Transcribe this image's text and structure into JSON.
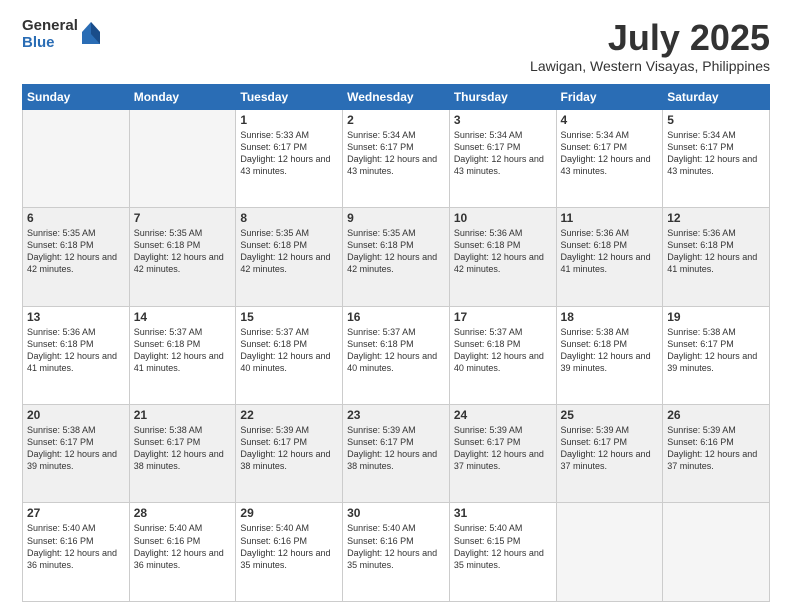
{
  "logo": {
    "general": "General",
    "blue": "Blue"
  },
  "header": {
    "month": "July 2025",
    "location": "Lawigan, Western Visayas, Philippines"
  },
  "weekdays": [
    "Sunday",
    "Monday",
    "Tuesday",
    "Wednesday",
    "Thursday",
    "Friday",
    "Saturday"
  ],
  "weeks": [
    [
      {
        "day": "",
        "info": ""
      },
      {
        "day": "",
        "info": ""
      },
      {
        "day": "1",
        "info": "Sunrise: 5:33 AM\nSunset: 6:17 PM\nDaylight: 12 hours and 43 minutes."
      },
      {
        "day": "2",
        "info": "Sunrise: 5:34 AM\nSunset: 6:17 PM\nDaylight: 12 hours and 43 minutes."
      },
      {
        "day": "3",
        "info": "Sunrise: 5:34 AM\nSunset: 6:17 PM\nDaylight: 12 hours and 43 minutes."
      },
      {
        "day": "4",
        "info": "Sunrise: 5:34 AM\nSunset: 6:17 PM\nDaylight: 12 hours and 43 minutes."
      },
      {
        "day": "5",
        "info": "Sunrise: 5:34 AM\nSunset: 6:17 PM\nDaylight: 12 hours and 43 minutes."
      }
    ],
    [
      {
        "day": "6",
        "info": "Sunrise: 5:35 AM\nSunset: 6:18 PM\nDaylight: 12 hours and 42 minutes."
      },
      {
        "day": "7",
        "info": "Sunrise: 5:35 AM\nSunset: 6:18 PM\nDaylight: 12 hours and 42 minutes."
      },
      {
        "day": "8",
        "info": "Sunrise: 5:35 AM\nSunset: 6:18 PM\nDaylight: 12 hours and 42 minutes."
      },
      {
        "day": "9",
        "info": "Sunrise: 5:35 AM\nSunset: 6:18 PM\nDaylight: 12 hours and 42 minutes."
      },
      {
        "day": "10",
        "info": "Sunrise: 5:36 AM\nSunset: 6:18 PM\nDaylight: 12 hours and 42 minutes."
      },
      {
        "day": "11",
        "info": "Sunrise: 5:36 AM\nSunset: 6:18 PM\nDaylight: 12 hours and 41 minutes."
      },
      {
        "day": "12",
        "info": "Sunrise: 5:36 AM\nSunset: 6:18 PM\nDaylight: 12 hours and 41 minutes."
      }
    ],
    [
      {
        "day": "13",
        "info": "Sunrise: 5:36 AM\nSunset: 6:18 PM\nDaylight: 12 hours and 41 minutes."
      },
      {
        "day": "14",
        "info": "Sunrise: 5:37 AM\nSunset: 6:18 PM\nDaylight: 12 hours and 41 minutes."
      },
      {
        "day": "15",
        "info": "Sunrise: 5:37 AM\nSunset: 6:18 PM\nDaylight: 12 hours and 40 minutes."
      },
      {
        "day": "16",
        "info": "Sunrise: 5:37 AM\nSunset: 6:18 PM\nDaylight: 12 hours and 40 minutes."
      },
      {
        "day": "17",
        "info": "Sunrise: 5:37 AM\nSunset: 6:18 PM\nDaylight: 12 hours and 40 minutes."
      },
      {
        "day": "18",
        "info": "Sunrise: 5:38 AM\nSunset: 6:18 PM\nDaylight: 12 hours and 39 minutes."
      },
      {
        "day": "19",
        "info": "Sunrise: 5:38 AM\nSunset: 6:17 PM\nDaylight: 12 hours and 39 minutes."
      }
    ],
    [
      {
        "day": "20",
        "info": "Sunrise: 5:38 AM\nSunset: 6:17 PM\nDaylight: 12 hours and 39 minutes."
      },
      {
        "day": "21",
        "info": "Sunrise: 5:38 AM\nSunset: 6:17 PM\nDaylight: 12 hours and 38 minutes."
      },
      {
        "day": "22",
        "info": "Sunrise: 5:39 AM\nSunset: 6:17 PM\nDaylight: 12 hours and 38 minutes."
      },
      {
        "day": "23",
        "info": "Sunrise: 5:39 AM\nSunset: 6:17 PM\nDaylight: 12 hours and 38 minutes."
      },
      {
        "day": "24",
        "info": "Sunrise: 5:39 AM\nSunset: 6:17 PM\nDaylight: 12 hours and 37 minutes."
      },
      {
        "day": "25",
        "info": "Sunrise: 5:39 AM\nSunset: 6:17 PM\nDaylight: 12 hours and 37 minutes."
      },
      {
        "day": "26",
        "info": "Sunrise: 5:39 AM\nSunset: 6:16 PM\nDaylight: 12 hours and 37 minutes."
      }
    ],
    [
      {
        "day": "27",
        "info": "Sunrise: 5:40 AM\nSunset: 6:16 PM\nDaylight: 12 hours and 36 minutes."
      },
      {
        "day": "28",
        "info": "Sunrise: 5:40 AM\nSunset: 6:16 PM\nDaylight: 12 hours and 36 minutes."
      },
      {
        "day": "29",
        "info": "Sunrise: 5:40 AM\nSunset: 6:16 PM\nDaylight: 12 hours and 35 minutes."
      },
      {
        "day": "30",
        "info": "Sunrise: 5:40 AM\nSunset: 6:16 PM\nDaylight: 12 hours and 35 minutes."
      },
      {
        "day": "31",
        "info": "Sunrise: 5:40 AM\nSunset: 6:15 PM\nDaylight: 12 hours and 35 minutes."
      },
      {
        "day": "",
        "info": ""
      },
      {
        "day": "",
        "info": ""
      }
    ]
  ]
}
